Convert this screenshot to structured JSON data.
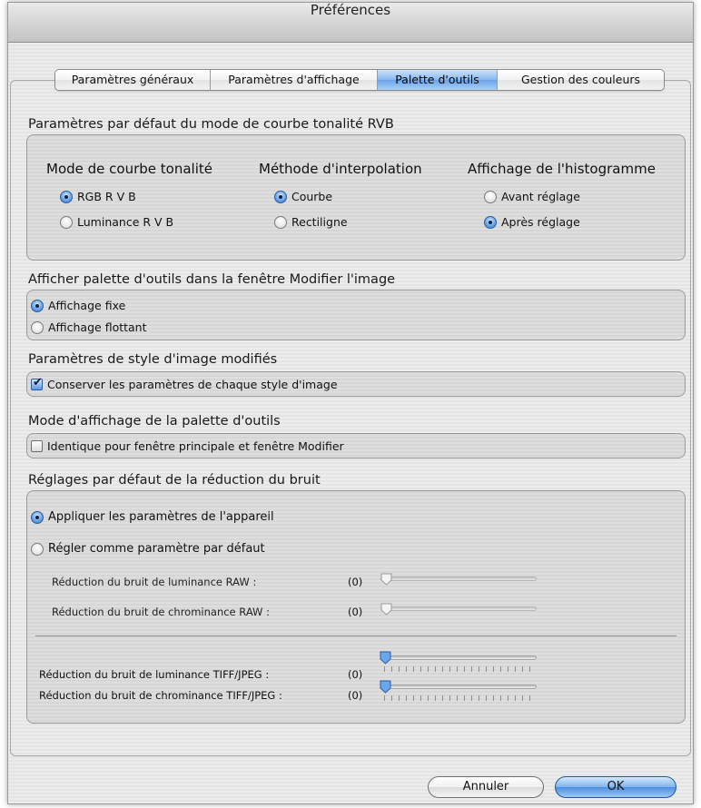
{
  "window": {
    "title": "Préférences"
  },
  "tabs": [
    {
      "label": "Paramètres généraux",
      "active": false
    },
    {
      "label": "Paramètres d'affichage",
      "active": false
    },
    {
      "label": "Palette d'outils",
      "active": true
    },
    {
      "label": "Gestion des couleurs",
      "active": false
    }
  ],
  "tone_curve": {
    "title": "Paramètres par défaut du mode de courbe tonalité RVB",
    "mode": {
      "heading": "Mode de courbe tonalité",
      "options": [
        {
          "label": "RGB R V B",
          "selected": true
        },
        {
          "label": "Luminance R V B",
          "selected": false
        }
      ]
    },
    "interpolation": {
      "heading": "Méthode d'interpolation",
      "options": [
        {
          "label": "Courbe",
          "selected": true
        },
        {
          "label": "Rectiligne",
          "selected": false
        }
      ]
    },
    "histogram": {
      "heading": "Affichage de l'histogramme",
      "options": [
        {
          "label": "Avant réglage",
          "selected": false
        },
        {
          "label": "Après réglage",
          "selected": true
        }
      ]
    }
  },
  "palette_display": {
    "title": "Afficher palette d'outils dans la fenêtre Modifier l'image",
    "options": [
      {
        "label": "Affichage fixe",
        "selected": true
      },
      {
        "label": "Affichage flottant",
        "selected": false
      }
    ]
  },
  "image_style": {
    "title": "Paramètres de style d'image modifiés",
    "checkbox_label": "Conserver les paramètres de chaque style d'image",
    "checked": true
  },
  "palette_mode": {
    "title": "Mode d'affichage de la palette d'outils",
    "checkbox_label": "Identique pour fenêtre principale et fenêtre Modifier",
    "checked": false
  },
  "noise": {
    "title": "Réglages par défaut de la réduction du bruit",
    "options": [
      {
        "label": "Appliquer les paramètres de l'appareil",
        "selected": true
      },
      {
        "label": "Régler comme paramètre par défaut",
        "selected": false
      }
    ],
    "raw_sliders": [
      {
        "label": "Réduction du bruit de luminance RAW :",
        "value": "(0)",
        "level": 0,
        "enabled": false
      },
      {
        "label": "Réduction du bruit de chrominance RAW :",
        "value": "(0)",
        "level": 0,
        "enabled": false
      }
    ],
    "tiff_sliders": [
      {
        "label": "Réduction du bruit de luminance TIFF/JPEG :",
        "value": "(0)",
        "level": 0,
        "enabled": true
      },
      {
        "label": "Réduction du bruit de chrominance TIFF/JPEG :",
        "value": "(0)",
        "level": 0,
        "enabled": true
      }
    ]
  },
  "buttons": {
    "cancel": "Annuler",
    "ok": "OK"
  },
  "colors": {
    "accent": "#5b99e0",
    "selected_tab": "#88b8ee"
  }
}
